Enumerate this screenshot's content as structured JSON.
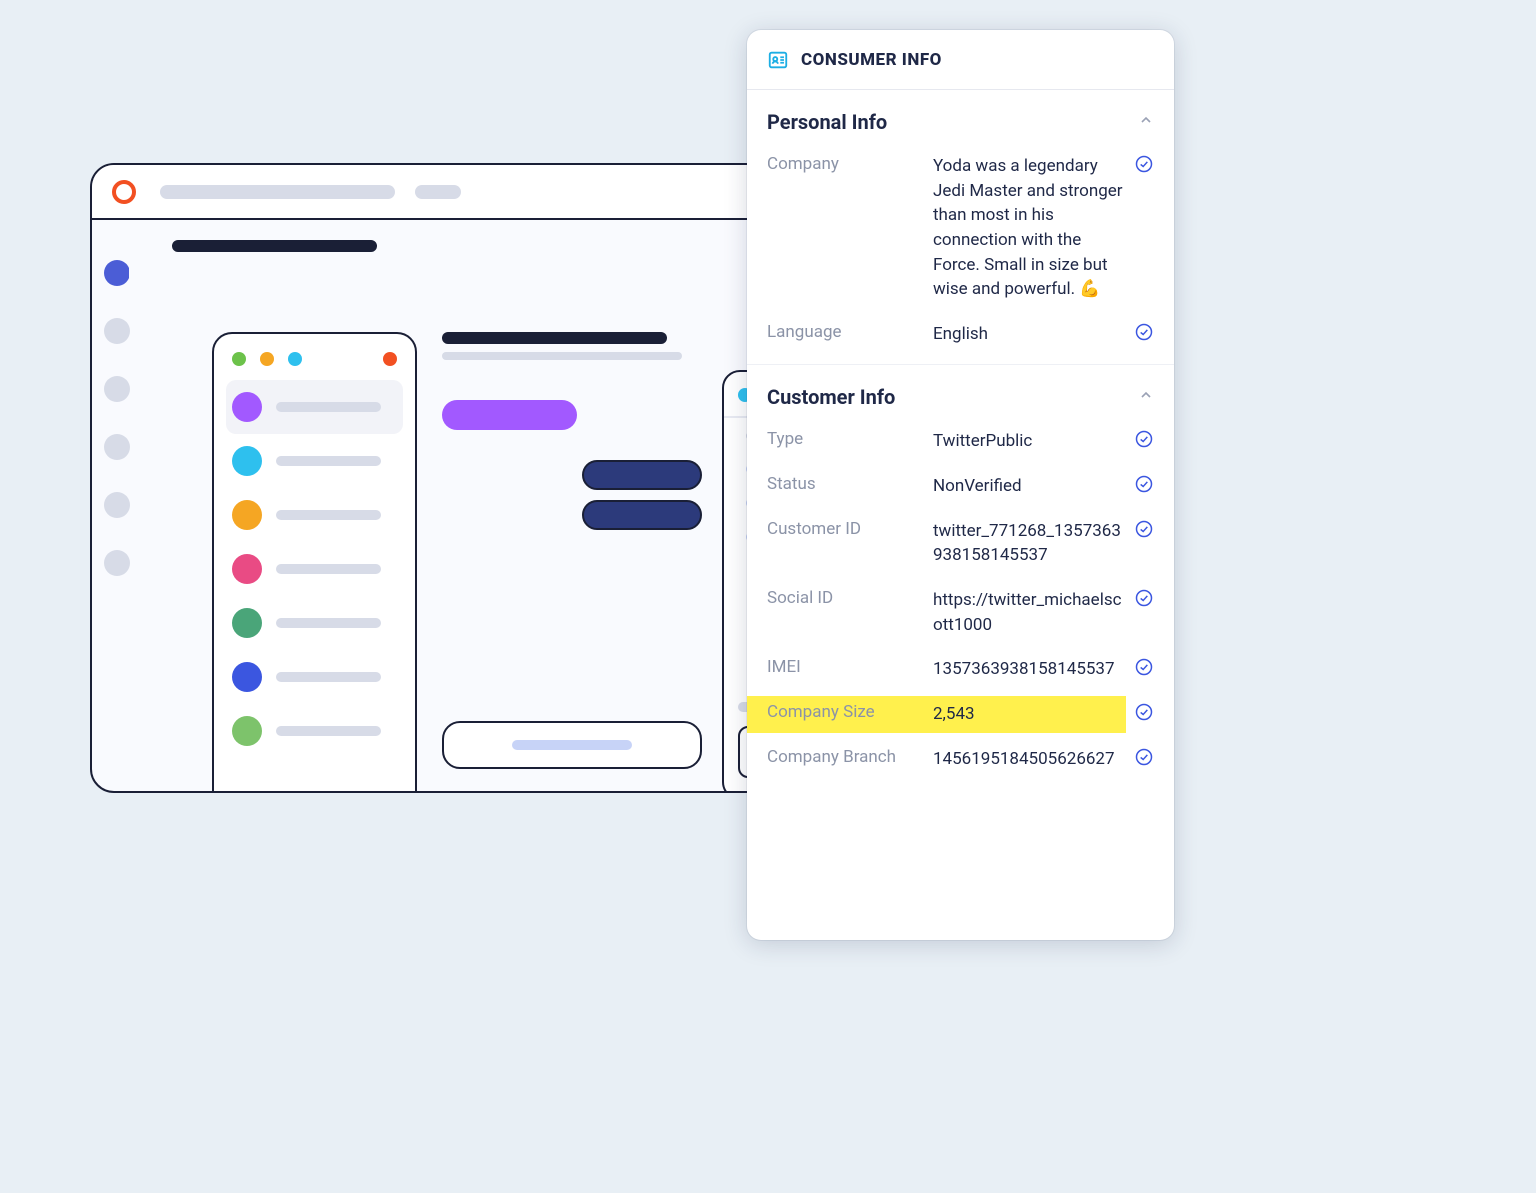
{
  "colors": {
    "accent": "#1caee4",
    "check": "#3b56e0",
    "highlight": "#fff04d"
  },
  "wireframe": {
    "channels": [
      {
        "name": "sail",
        "color": "#a259ff"
      },
      {
        "name": "arrow",
        "color": "#2ec0ee"
      },
      {
        "name": "music",
        "color": "#f5a623"
      },
      {
        "name": "piggy",
        "color": "#e94b84"
      },
      {
        "name": "leaf",
        "color": "#4aa579"
      },
      {
        "name": "globe",
        "color": "#3b56e0"
      },
      {
        "name": "snake",
        "color": "#7dc36b"
      }
    ]
  },
  "panel": {
    "title": "CONSUMER INFO",
    "sections": {
      "personal": {
        "title": "Personal Info",
        "fields": {
          "company": {
            "label": "Company",
            "value": "Yoda was a legendary Jedi Master and stronger than most in his connection with the Force. Small in size but wise and powerful. 💪"
          },
          "language": {
            "label": "Language",
            "value": "English"
          }
        }
      },
      "customer": {
        "title": "Customer Info",
        "fields": {
          "type": {
            "label": "Type",
            "value": "TwitterPublic"
          },
          "status": {
            "label": "Status",
            "value": "NonVerified"
          },
          "customer_id": {
            "label": "Customer ID",
            "value": "twitter_771268_1357363938158145537"
          },
          "social_id": {
            "label": "Social ID",
            "value": "https://twitter_michaelscott1000"
          },
          "imei": {
            "label": "IMEI",
            "value": "1357363938158145537"
          },
          "company_size": {
            "label": "Company Size",
            "value": "2,543"
          },
          "company_branch": {
            "label": "Company Branch",
            "value": "1456195184505626627"
          }
        }
      }
    }
  }
}
